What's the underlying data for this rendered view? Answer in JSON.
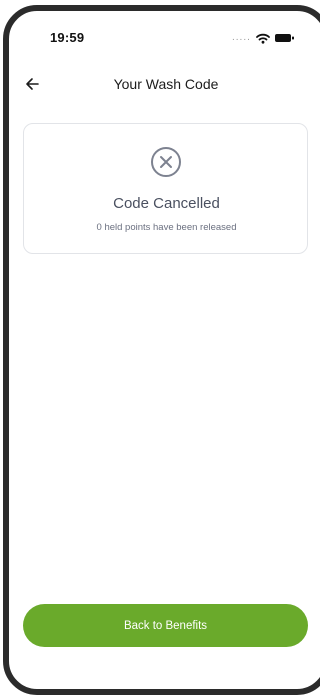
{
  "status_bar": {
    "time": "19:59",
    "signal_icon": "signal-dots-icon",
    "wifi_icon": "wifi-icon",
    "battery_icon": "battery-icon"
  },
  "header": {
    "back_icon": "arrow-left-icon",
    "title": "Your Wash Code"
  },
  "status_card": {
    "icon": "x-circle-icon",
    "title": "Code Cancelled",
    "message": "0 held points have been released"
  },
  "footer": {
    "button_label": "Back to Benefits"
  },
  "colors": {
    "accent": "#6aaa2b",
    "icon_gray": "#7d8290",
    "card_border": "#e2e4e8"
  }
}
